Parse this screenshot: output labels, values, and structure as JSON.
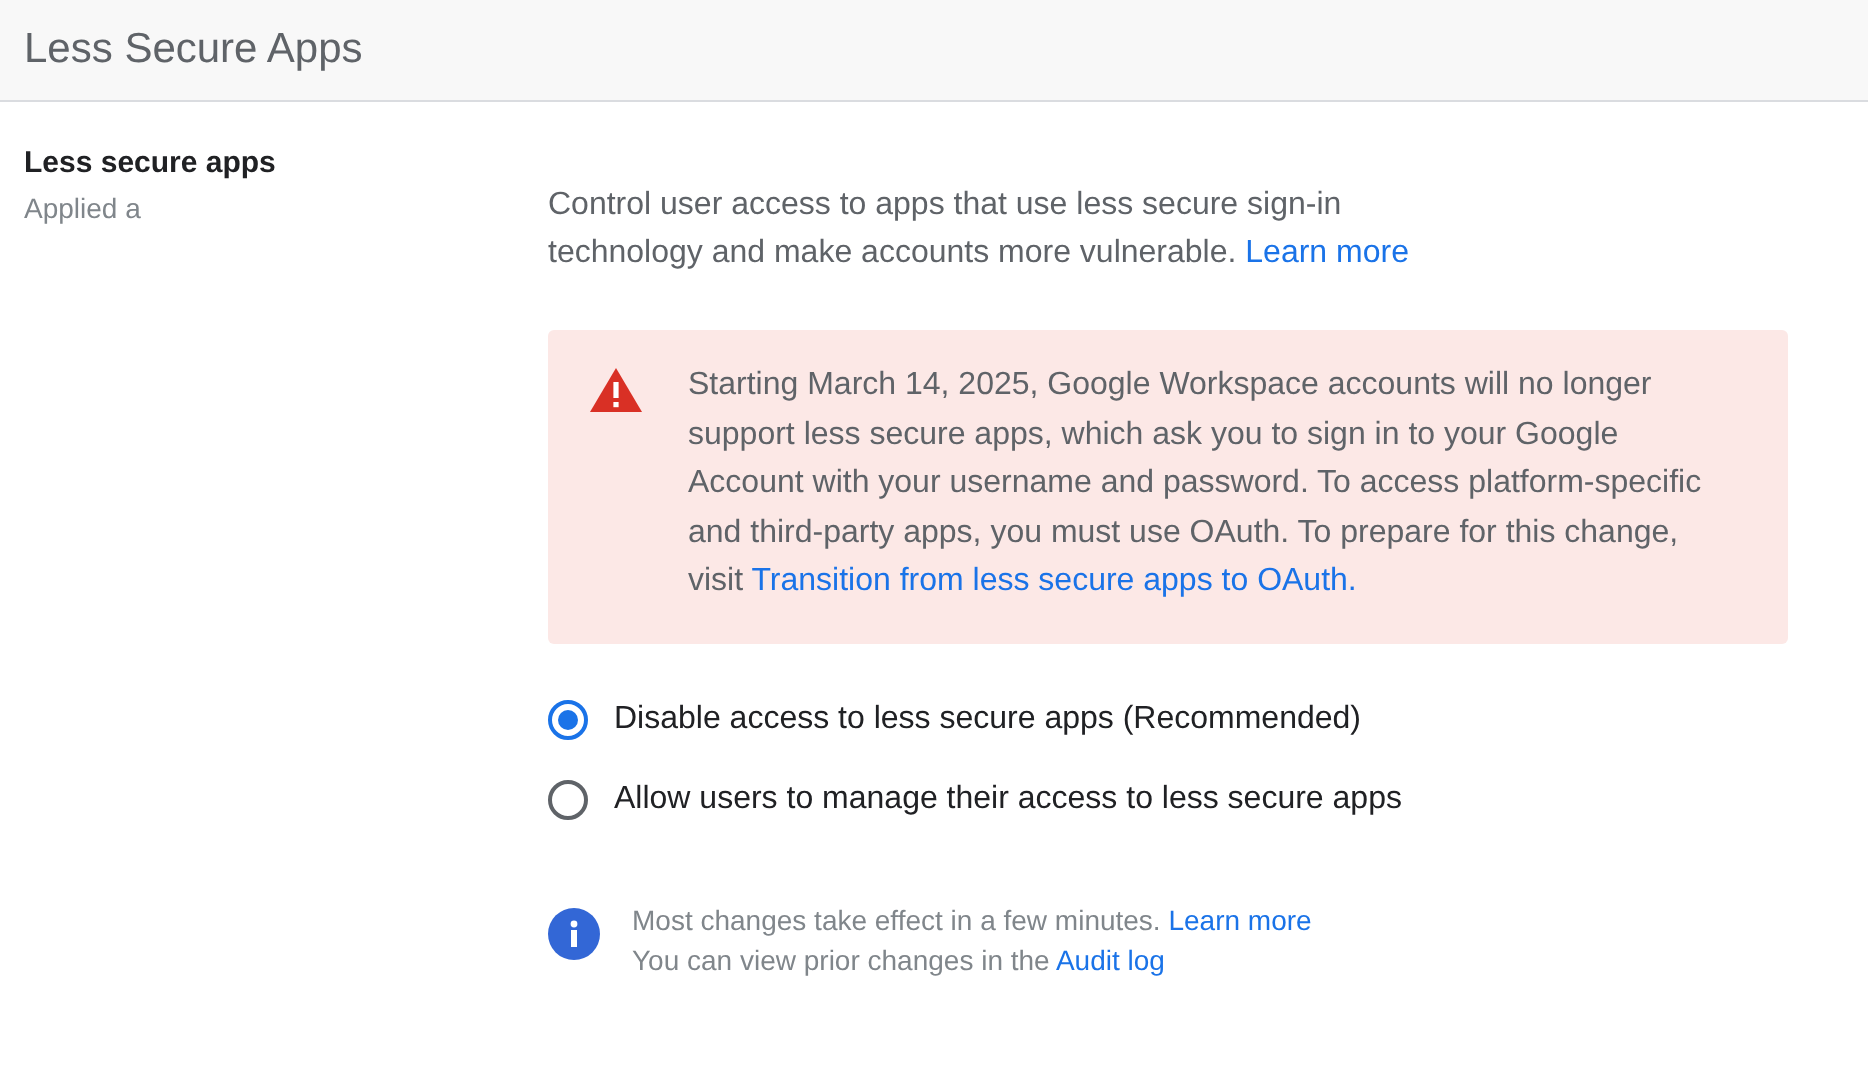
{
  "header": {
    "title": "Less Secure Apps"
  },
  "section": {
    "title": "Less secure apps",
    "subtitle": "Applied a"
  },
  "description": {
    "text": "Control user access to apps that use less secure sign-in technology and make accounts more vulnerable.",
    "link": "Learn more"
  },
  "warning": {
    "text": "Starting March 14, 2025, Google Workspace accounts will no longer support less secure apps, which ask you to sign in to your Google Account with your username and password. To access platform-specific and third-party apps, you must use OAuth. To prepare for this change, visit ",
    "link": "Transition from less secure apps to OAuth."
  },
  "options": [
    {
      "label": "Disable access to less secure apps (Recommended)",
      "selected": true
    },
    {
      "label": "Allow users to manage their access to less secure apps",
      "selected": false
    }
  ],
  "info": {
    "line1": "Most changes take effect in a few minutes.",
    "link1": "Learn more",
    "line2": "You can view prior changes in the",
    "link2": "Audit log"
  }
}
